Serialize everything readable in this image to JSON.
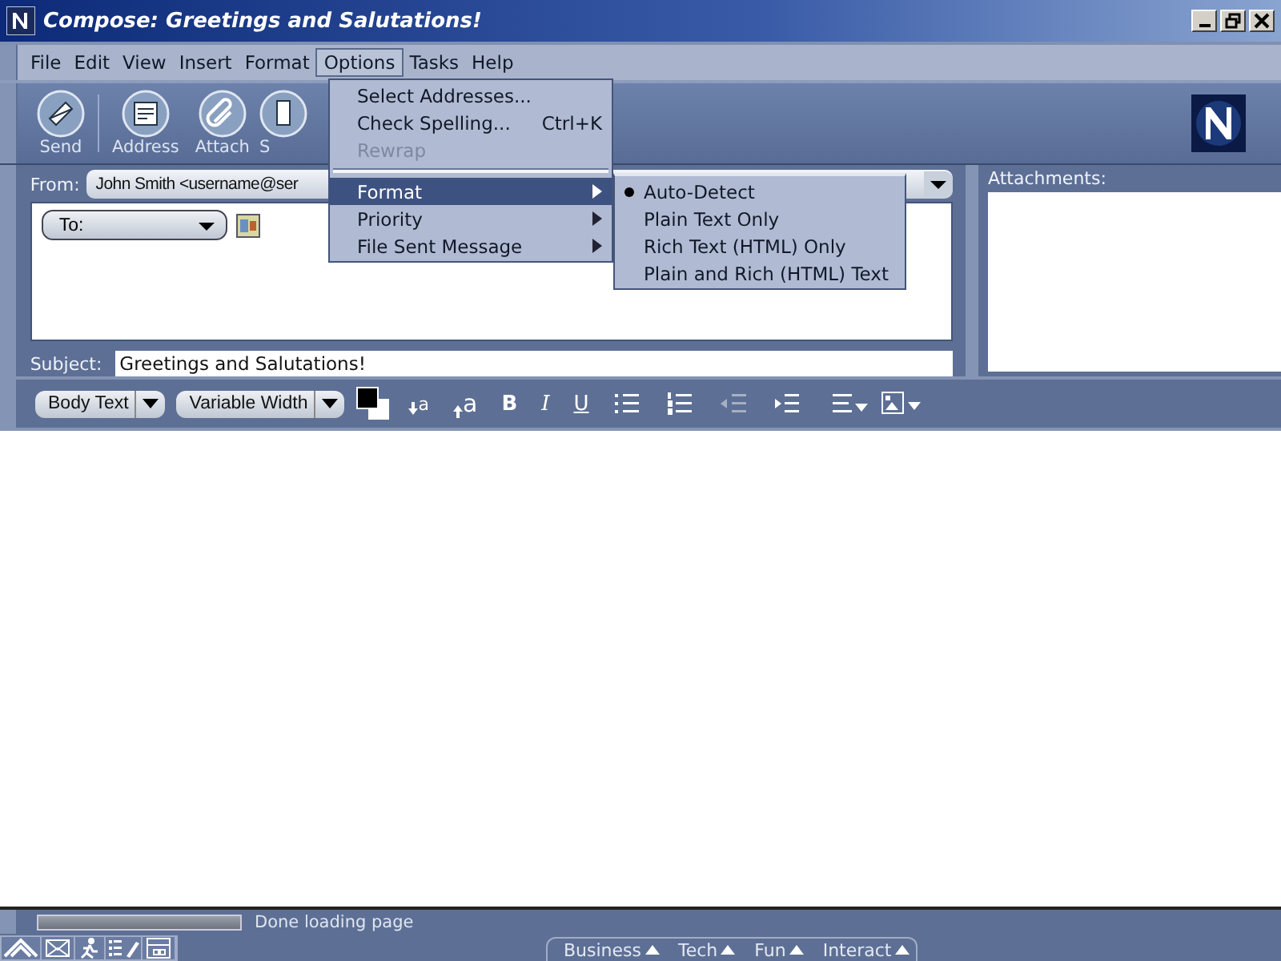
{
  "window": {
    "title": "Compose: Greetings and Salutations!"
  },
  "menu_bar": [
    {
      "label": "File",
      "selected": false
    },
    {
      "label": "Edit",
      "selected": false
    },
    {
      "label": "View",
      "selected": false
    },
    {
      "label": "Insert",
      "selected": false
    },
    {
      "label": "Format",
      "selected": false
    },
    {
      "label": "Options",
      "selected": true
    },
    {
      "label": "Tasks",
      "selected": false
    },
    {
      "label": "Help",
      "selected": false
    }
  ],
  "options_menu": [
    {
      "kind": "item",
      "label": "Select Addresses...",
      "disabled": false,
      "selected": false
    },
    {
      "kind": "item",
      "label": "Check Spelling...",
      "shortcut": "Ctrl+K",
      "disabled": false,
      "selected": false
    },
    {
      "kind": "item",
      "label": "Rewrap",
      "disabled": true,
      "selected": false
    },
    {
      "kind": "separator"
    },
    {
      "kind": "submenu",
      "label": "Format",
      "disabled": false,
      "selected": true
    },
    {
      "kind": "submenu",
      "label": "Priority",
      "disabled": false,
      "selected": false
    },
    {
      "kind": "submenu",
      "label": "File Sent Message",
      "disabled": false,
      "selected": false
    }
  ],
  "format_submenu": [
    {
      "label": "Auto-Detect",
      "selected": true
    },
    {
      "label": "Plain Text Only",
      "selected": false
    },
    {
      "label": "Rich Text (HTML) Only",
      "selected": false
    },
    {
      "label": "Plain and Rich (HTML) Text",
      "selected": false
    }
  ],
  "toolbar": [
    {
      "kind": "send",
      "label": "Send"
    },
    {
      "kind": "address",
      "label": "Address"
    },
    {
      "kind": "attach",
      "label": "Attach"
    },
    {
      "kind": "spell",
      "label": "S"
    }
  ],
  "header": {
    "from_label": "From:",
    "from_value": "John Smith <username@ser",
    "to_label": "To:",
    "subject_label": "Subject:",
    "subject_value": "Greetings and Salutations!",
    "attachments_label": "Attachments:"
  },
  "format_toolbar": {
    "paragraph_style": "Body Text",
    "font": "Variable Width",
    "size_buttons": [
      {
        "kind": "smaller",
        "label": "a"
      },
      {
        "kind": "larger",
        "label": "a"
      }
    ],
    "style_buttons": [
      {
        "kind": "bold",
        "label": "B"
      },
      {
        "kind": "italic",
        "label": "I"
      },
      {
        "kind": "underline",
        "label": "U"
      }
    ],
    "list_buttons": [
      {
        "kind": "bullets",
        "disabled": false
      },
      {
        "kind": "numbers",
        "disabled": false
      },
      {
        "kind": "outdent",
        "disabled": true
      },
      {
        "kind": "indent",
        "disabled": false
      }
    ]
  },
  "status_bar": {
    "progress": {
      "level": 1
    },
    "text": "Done loading page"
  },
  "bottom_tabs": [
    {
      "label": "Business"
    },
    {
      "label": "Tech"
    },
    {
      "label": "Fun"
    },
    {
      "label": "Interact"
    }
  ]
}
